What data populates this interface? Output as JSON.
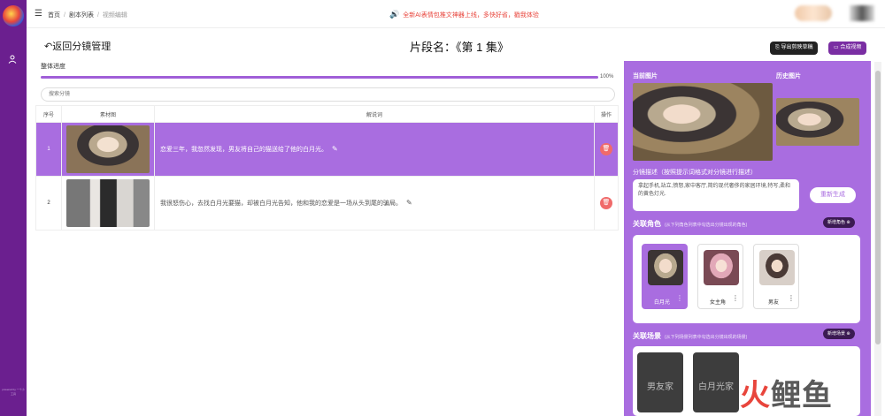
{
  "header": {
    "breadcrumb": [
      "首页",
      "剧本列表",
      "视频编辑"
    ],
    "notice": "全新AI表情包推文神器上线，多快好省，戳我体验"
  },
  "sidebar": {
    "footer": "powered by 一个小工具"
  },
  "page": {
    "back_label": "返回分镜管理",
    "title": "片段名：《第 1 集》",
    "export_label": "导出剪映草稿",
    "compose_label": "合成视频"
  },
  "progress": {
    "label": "整体进度",
    "value": 100,
    "text": "100%"
  },
  "search": {
    "placeholder": "搜索分镜"
  },
  "table": {
    "headers": [
      "序号",
      "素材图",
      "解说词",
      "操作"
    ],
    "rows": [
      {
        "index": "1",
        "text": "恋爱三年，我忽然发现，男友将自己的猫送给了他的白月光。",
        "selected": true
      },
      {
        "index": "2",
        "text": "我很怒伤心，去找白月光要猫，却被白月光告知，他和我的恋爱是一场从头到尾的骗局。",
        "selected": false
      }
    ]
  },
  "panel": {
    "current_label": "当前图片",
    "history_label": "历史图片",
    "desc_label": "分镜描述（按照提示词格式对分镜进行描述）",
    "desc_text": "拿起手机,站立,愤怒,家中客厅,简约现代奢侈的家居环境,特写,柔和的黄色灯光.",
    "regen_label": "重新生成",
    "char_title": "关联角色",
    "char_hint": "(从下列角色列表中勾选出分镜出现的角色)",
    "new_char": "新增角色 ⊕",
    "characters": [
      {
        "name": "白月光",
        "selected": true
      },
      {
        "name": "女主角",
        "selected": false
      },
      {
        "name": "男友",
        "selected": false
      }
    ],
    "scene_title": "关联场景",
    "scene_hint": "(从下列场景列表中勾选出分镜出现的场景)",
    "new_scene": "新增场景 ⊕",
    "scenes": [
      "男友家",
      "白月光家"
    ]
  },
  "watermark": {
    "a": "火",
    "b": "鲤鱼"
  },
  "colors": {
    "sidebar": "#6b1f8f",
    "accent": "#a96de0",
    "danger": "#f06a6a"
  }
}
